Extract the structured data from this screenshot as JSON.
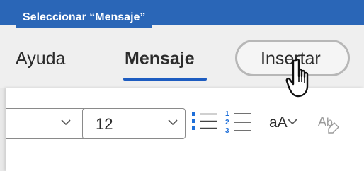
{
  "callout": {
    "text": "Seleccionar “Mensaje”"
  },
  "tabs": [
    {
      "label": "Ayuda"
    },
    {
      "label": "Mensaje",
      "active": true
    },
    {
      "label": "Insertar",
      "hovered": true
    }
  ],
  "ribbon": {
    "font_size_value": "12",
    "change_case_label": "aA"
  },
  "colors": {
    "accent": "#2a66b7",
    "tab_underline": "#1d5cc0",
    "list_icon_blue": "#1e6fd9"
  },
  "icons": {
    "cursor": "hand-pointer-icon",
    "bullets": "bulleted-list-icon",
    "numbering": "numbered-list-icon",
    "clear_formatting": "clear-formatting-icon",
    "chevron": "chevron-down-icon"
  }
}
